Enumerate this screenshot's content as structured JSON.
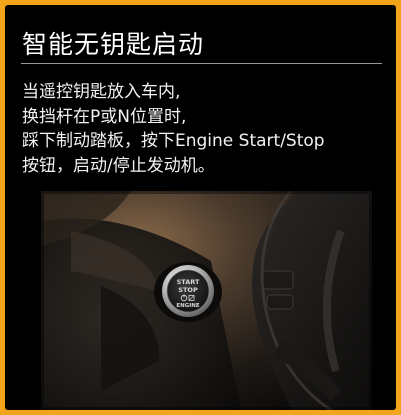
{
  "header": {
    "title": "智能无钥匙启动"
  },
  "description": {
    "lines": [
      "当遥控钥匙放入车内,",
      "换挡杆在P或N位置时,",
      "踩下制动踏板，按下Engine Start/Stop",
      "按钮，启动/停止发动机。"
    ]
  },
  "photo": {
    "button_label_line1": "START",
    "button_label_line2": "STOP",
    "button_label_line3": "ENGINE"
  },
  "colors": {
    "border": "#f2a51a",
    "background": "#000000",
    "text": "#ffffff",
    "accent_ring": "#c9c9c9"
  },
  "icons": [
    "start-stop-button-icon",
    "power-icon"
  ]
}
